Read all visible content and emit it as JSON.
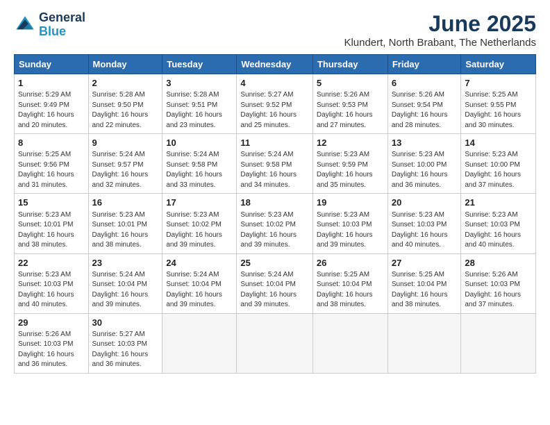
{
  "logo": {
    "line1": "General",
    "line2": "Blue"
  },
  "title": "June 2025",
  "location": "Klundert, North Brabant, The Netherlands",
  "weekdays": [
    "Sunday",
    "Monday",
    "Tuesday",
    "Wednesday",
    "Thursday",
    "Friday",
    "Saturday"
  ],
  "weeks": [
    [
      {
        "day": "1",
        "detail": "Sunrise: 5:29 AM\nSunset: 9:49 PM\nDaylight: 16 hours\nand 20 minutes."
      },
      {
        "day": "2",
        "detail": "Sunrise: 5:28 AM\nSunset: 9:50 PM\nDaylight: 16 hours\nand 22 minutes."
      },
      {
        "day": "3",
        "detail": "Sunrise: 5:28 AM\nSunset: 9:51 PM\nDaylight: 16 hours\nand 23 minutes."
      },
      {
        "day": "4",
        "detail": "Sunrise: 5:27 AM\nSunset: 9:52 PM\nDaylight: 16 hours\nand 25 minutes."
      },
      {
        "day": "5",
        "detail": "Sunrise: 5:26 AM\nSunset: 9:53 PM\nDaylight: 16 hours\nand 27 minutes."
      },
      {
        "day": "6",
        "detail": "Sunrise: 5:26 AM\nSunset: 9:54 PM\nDaylight: 16 hours\nand 28 minutes."
      },
      {
        "day": "7",
        "detail": "Sunrise: 5:25 AM\nSunset: 9:55 PM\nDaylight: 16 hours\nand 30 minutes."
      }
    ],
    [
      {
        "day": "8",
        "detail": "Sunrise: 5:25 AM\nSunset: 9:56 PM\nDaylight: 16 hours\nand 31 minutes."
      },
      {
        "day": "9",
        "detail": "Sunrise: 5:24 AM\nSunset: 9:57 PM\nDaylight: 16 hours\nand 32 minutes."
      },
      {
        "day": "10",
        "detail": "Sunrise: 5:24 AM\nSunset: 9:58 PM\nDaylight: 16 hours\nand 33 minutes."
      },
      {
        "day": "11",
        "detail": "Sunrise: 5:24 AM\nSunset: 9:58 PM\nDaylight: 16 hours\nand 34 minutes."
      },
      {
        "day": "12",
        "detail": "Sunrise: 5:23 AM\nSunset: 9:59 PM\nDaylight: 16 hours\nand 35 minutes."
      },
      {
        "day": "13",
        "detail": "Sunrise: 5:23 AM\nSunset: 10:00 PM\nDaylight: 16 hours\nand 36 minutes."
      },
      {
        "day": "14",
        "detail": "Sunrise: 5:23 AM\nSunset: 10:00 PM\nDaylight: 16 hours\nand 37 minutes."
      }
    ],
    [
      {
        "day": "15",
        "detail": "Sunrise: 5:23 AM\nSunset: 10:01 PM\nDaylight: 16 hours\nand 38 minutes."
      },
      {
        "day": "16",
        "detail": "Sunrise: 5:23 AM\nSunset: 10:01 PM\nDaylight: 16 hours\nand 38 minutes."
      },
      {
        "day": "17",
        "detail": "Sunrise: 5:23 AM\nSunset: 10:02 PM\nDaylight: 16 hours\nand 39 minutes."
      },
      {
        "day": "18",
        "detail": "Sunrise: 5:23 AM\nSunset: 10:02 PM\nDaylight: 16 hours\nand 39 minutes."
      },
      {
        "day": "19",
        "detail": "Sunrise: 5:23 AM\nSunset: 10:03 PM\nDaylight: 16 hours\nand 39 minutes."
      },
      {
        "day": "20",
        "detail": "Sunrise: 5:23 AM\nSunset: 10:03 PM\nDaylight: 16 hours\nand 40 minutes."
      },
      {
        "day": "21",
        "detail": "Sunrise: 5:23 AM\nSunset: 10:03 PM\nDaylight: 16 hours\nand 40 minutes."
      }
    ],
    [
      {
        "day": "22",
        "detail": "Sunrise: 5:23 AM\nSunset: 10:03 PM\nDaylight: 16 hours\nand 40 minutes."
      },
      {
        "day": "23",
        "detail": "Sunrise: 5:24 AM\nSunset: 10:04 PM\nDaylight: 16 hours\nand 39 minutes."
      },
      {
        "day": "24",
        "detail": "Sunrise: 5:24 AM\nSunset: 10:04 PM\nDaylight: 16 hours\nand 39 minutes."
      },
      {
        "day": "25",
        "detail": "Sunrise: 5:24 AM\nSunset: 10:04 PM\nDaylight: 16 hours\nand 39 minutes."
      },
      {
        "day": "26",
        "detail": "Sunrise: 5:25 AM\nSunset: 10:04 PM\nDaylight: 16 hours\nand 38 minutes."
      },
      {
        "day": "27",
        "detail": "Sunrise: 5:25 AM\nSunset: 10:04 PM\nDaylight: 16 hours\nand 38 minutes."
      },
      {
        "day": "28",
        "detail": "Sunrise: 5:26 AM\nSunset: 10:03 PM\nDaylight: 16 hours\nand 37 minutes."
      }
    ],
    [
      {
        "day": "29",
        "detail": "Sunrise: 5:26 AM\nSunset: 10:03 PM\nDaylight: 16 hours\nand 36 minutes."
      },
      {
        "day": "30",
        "detail": "Sunrise: 5:27 AM\nSunset: 10:03 PM\nDaylight: 16 hours\nand 36 minutes."
      },
      {
        "day": "",
        "detail": ""
      },
      {
        "day": "",
        "detail": ""
      },
      {
        "day": "",
        "detail": ""
      },
      {
        "day": "",
        "detail": ""
      },
      {
        "day": "",
        "detail": ""
      }
    ]
  ]
}
